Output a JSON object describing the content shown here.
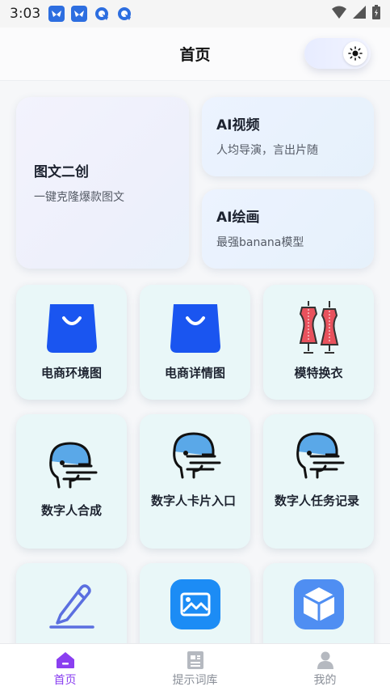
{
  "status_bar": {
    "time": "3:03"
  },
  "header": {
    "title": "首页"
  },
  "feature_cards": {
    "big": {
      "title": "图文二创",
      "subtitle": "一键克隆爆款图文"
    },
    "video": {
      "title": "AI视频",
      "subtitle": "人均导演，言出片随"
    },
    "drawing": {
      "title": "AI绘画",
      "subtitle": "最强banana模型"
    }
  },
  "tools": [
    {
      "label": "电商环境图",
      "icon": "shopping-bag-icon"
    },
    {
      "label": "电商详情图",
      "icon": "shopping-bag-icon"
    },
    {
      "label": "模特换衣",
      "icon": "mannequin-icon"
    },
    {
      "label": "数字人合成",
      "icon": "digital-human-icon"
    },
    {
      "label": "数字人卡片入口",
      "icon": "digital-human-icon"
    },
    {
      "label": "数字人任务记录",
      "icon": "digital-human-icon"
    },
    {
      "label": "",
      "icon": "pencil-icon"
    },
    {
      "label": "",
      "icon": "image-icon"
    },
    {
      "label": "",
      "icon": "cube-icon"
    }
  ],
  "bottom_nav": [
    {
      "label": "首页",
      "icon": "home-icon",
      "active": true
    },
    {
      "label": "提示词库",
      "icon": "document-icon",
      "active": false
    },
    {
      "label": "我的",
      "icon": "user-icon",
      "active": false
    }
  ],
  "colors": {
    "accent": "#8a3ff0",
    "bag_blue": "#1a55f0",
    "tile_bg": "#e9f7f8",
    "head_blue": "#5aa8e8"
  }
}
